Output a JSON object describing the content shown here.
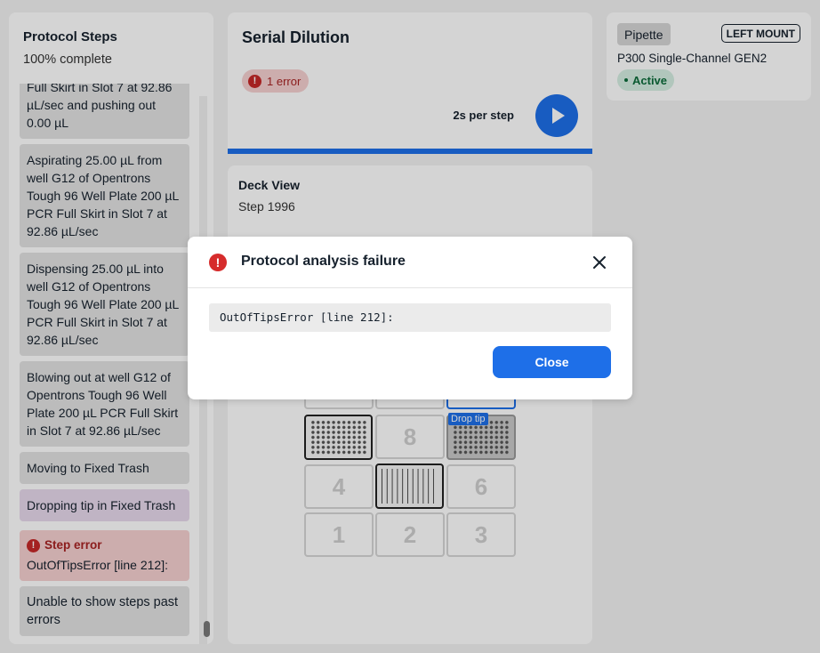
{
  "steps_panel": {
    "title": "Protocol Steps",
    "progress": "100% complete",
    "steps": [
      "Full Skirt in Slot 7 at 92.86 µL/sec and pushing out 0.00 µL",
      "Aspirating 25.00 µL from well G12 of Opentrons Tough 96 Well Plate 200 µL PCR Full Skirt in Slot 7 at 92.86 µL/sec",
      "Dispensing 25.00 µL into well G12 of Opentrons Tough 96 Well Plate 200 µL PCR Full Skirt in Slot 7 at 92.86 µL/sec",
      "Blowing out at well G12 of Opentrons Tough 96 Well Plate 200 µL PCR Full Skirt in Slot 7 at 92.86 µL/sec",
      "Moving to Fixed Trash",
      "Dropping tip in Fixed Trash"
    ],
    "error_step": {
      "title": "Step error",
      "message": "OutOfTipsError [line 212]:"
    },
    "unable_msg": "Unable to show steps past errors"
  },
  "header": {
    "title": "Serial Dilution",
    "error_count": "1 error",
    "speed": "2s per step",
    "play_icon": "play-icon",
    "progress": 1.0
  },
  "deck": {
    "title": "Deck View",
    "step": "Step 1996",
    "drop_tip_label": "Drop tip",
    "slots": {
      "s8": "8",
      "s4": "4",
      "s6": "6",
      "s1": "1",
      "s2": "2",
      "s3": "3"
    }
  },
  "pipette": {
    "label": "Pipette",
    "mount": "LEFT MOUNT",
    "name": "P300 Single-Channel GEN2",
    "status": "Active"
  },
  "modal": {
    "title": "Protocol analysis failure",
    "code": "OutOfTipsError [line 212]:",
    "close_label": "Close",
    "close_icon": "close-icon",
    "error_icon": "error-icon"
  },
  "colors": {
    "accent": "#1e6fe8",
    "error": "#d62c2c",
    "success": "#0b6b3a"
  }
}
